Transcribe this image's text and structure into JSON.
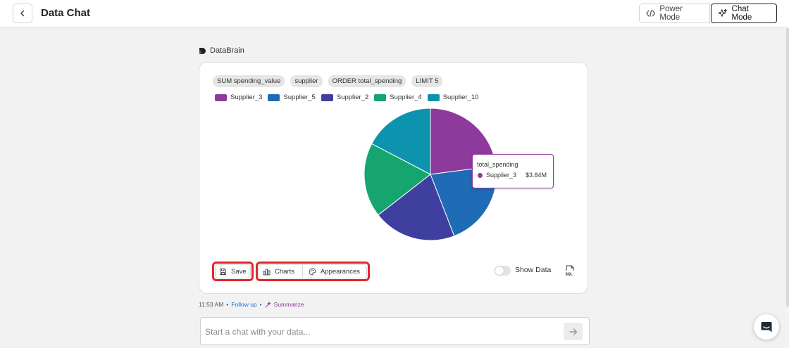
{
  "header": {
    "back_icon": "chevron-left-icon",
    "title": "Data Chat",
    "power_mode_label": "Power Mode",
    "power_mode_icon": "code-icon",
    "chat_mode_label": "Chat Mode",
    "chat_mode_icon": "sparkle-icon",
    "active_mode": "Chat Mode"
  },
  "message": {
    "sender": "DataBrain",
    "sender_icon": "databrain-logo-icon",
    "chips": [
      "SUM spending_value",
      "supplier",
      "ORDER total_spending",
      "LIMIT 5"
    ],
    "tooltip": {
      "title": "total_spending",
      "series": "Supplier_3",
      "value": "$3.84M"
    },
    "toolbar": {
      "save_label": "Save",
      "charts_label": "Charts",
      "appearances_label": "Appearances",
      "show_data_label": "Show Data",
      "show_data_on": false,
      "sql_icon": "sql-file-icon"
    },
    "timestamp": "11:53 AM",
    "followup_label": "Follow up",
    "summarize_label": "Summarize",
    "separator": "•"
  },
  "chart_data": {
    "type": "pie",
    "title": "",
    "labels": [
      "Supplier_3",
      "Supplier_5",
      "Supplier_2",
      "Supplier_4",
      "Supplier_10"
    ],
    "values": [
      3.84,
      3.55,
      3.4,
      3.05,
      2.9
    ],
    "colors": [
      "#8e3a9d",
      "#1f6bb5",
      "#3f3f9f",
      "#16a56e",
      "#0d93ad"
    ],
    "legend_position": "top-left",
    "value_label": "total_spending"
  },
  "chat": {
    "placeholder": "Start a chat with your data...",
    "send_icon": "arrow-right-icon"
  },
  "fab": {
    "icon": "chat-bubble-icon"
  },
  "colors": {
    "accent": "#8e3a9d",
    "highlight": "#e0282e",
    "link": "#1d6fd8"
  }
}
